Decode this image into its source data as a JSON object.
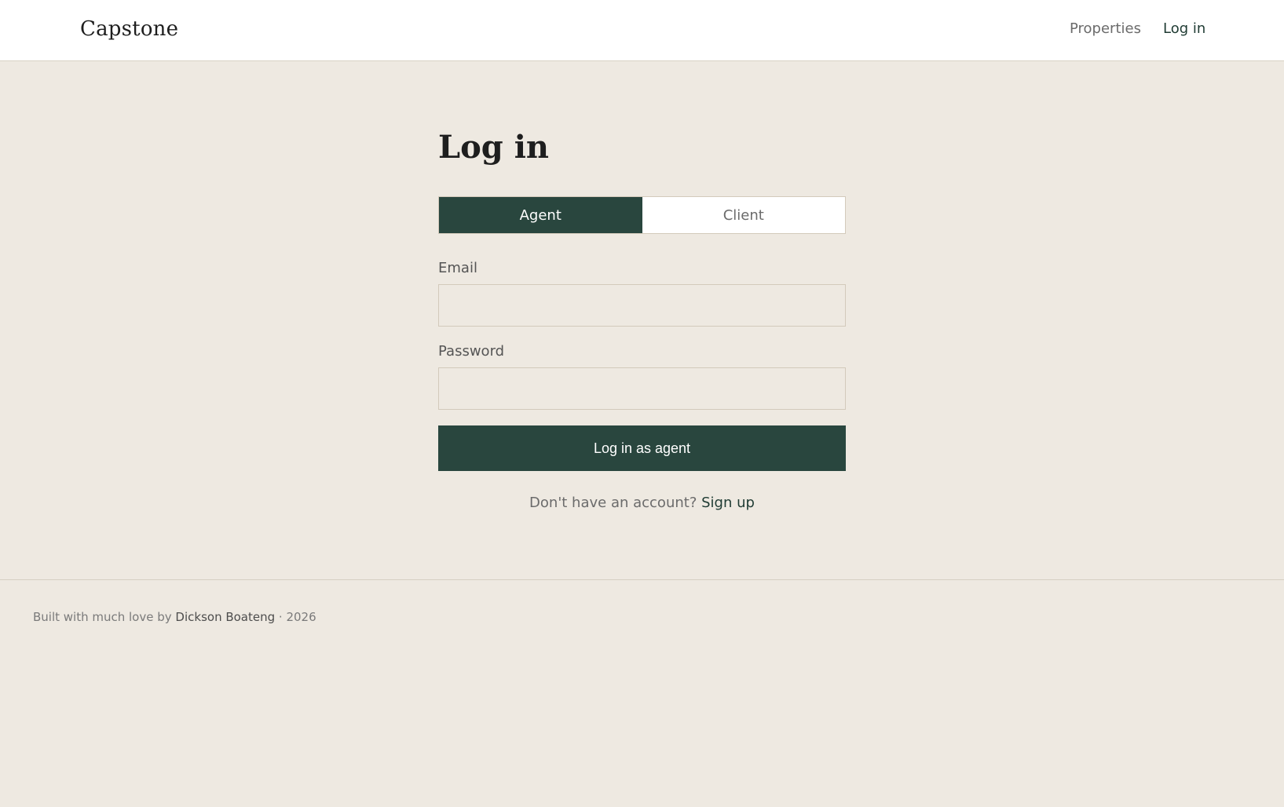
{
  "header": {
    "brand": "Capstone",
    "nav": {
      "properties": "Properties",
      "login": "Log in"
    }
  },
  "main": {
    "title": "Log in",
    "tabs": {
      "agent": "Agent",
      "client": "Client",
      "selected": "Agent"
    },
    "email": {
      "label": "Email",
      "value": "",
      "placeholder": ""
    },
    "password": {
      "label": "Password",
      "value": "",
      "placeholder": ""
    },
    "submit_label": "Log in as agent",
    "signup": {
      "prompt": "Don't have an account?",
      "link": "Sign up"
    }
  },
  "footer": {
    "prefix": "Built with much love by",
    "author": "Dickson Boateng",
    "suffix": "· 2026"
  },
  "colors": {
    "accent": "#29463e",
    "background": "#eee9e1",
    "header_bg": "#ffffff"
  }
}
